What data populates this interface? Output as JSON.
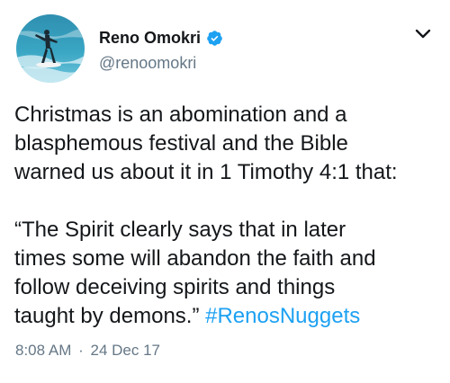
{
  "tweet": {
    "author": {
      "display_name": "Reno Omokri",
      "handle": "@renoomokri",
      "verified": true
    },
    "text_paragraph_1": "Christmas is an abomination and a\nblasphemous festival and the Bible\nwarned us about it in 1 Timothy 4:1 that:",
    "text_paragraph_2": "“The Spirit clearly says that in later\ntimes some will abandon the faith and\nfollow deceiving spirits and things\ntaught by demons.” ",
    "hashtag": "#RenosNuggets",
    "time": "8:08 AM",
    "separator": "·",
    "date": "24 Dec 17"
  },
  "icons": {
    "menu": "chevron-down-icon",
    "verified": "verified-badge-icon",
    "avatar": "avatar"
  },
  "colors": {
    "link": "#1da1f2",
    "secondary_text": "#657786",
    "primary_text": "#14171a"
  }
}
